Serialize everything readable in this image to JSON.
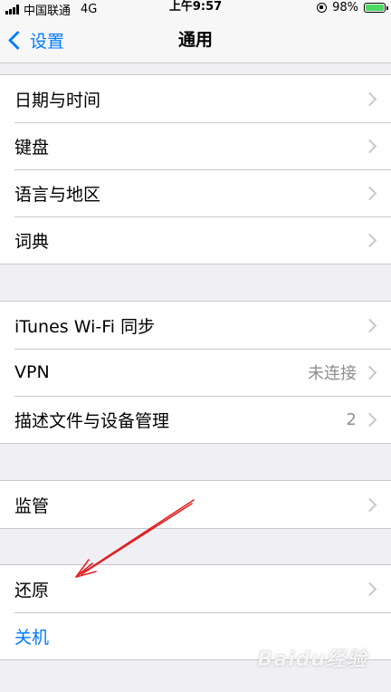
{
  "status_bar": {
    "carrier": "中国联通",
    "network": "4G",
    "time": "上午9:57",
    "battery_percent": "98%",
    "battery_level": 0.98,
    "battery_color": "#4cd964"
  },
  "nav": {
    "back_label": "设置",
    "title": "通用",
    "accent_color": "#007aff"
  },
  "groups": [
    {
      "rows": [
        {
          "label": "日期与时间"
        },
        {
          "label": "键盘"
        },
        {
          "label": "语言与地区"
        },
        {
          "label": "词典"
        }
      ]
    },
    {
      "rows": [
        {
          "label": "iTunes Wi-Fi 同步"
        },
        {
          "label": "VPN",
          "detail": "未连接"
        },
        {
          "label": "描述文件与设备管理",
          "detail": "2"
        }
      ]
    },
    {
      "rows": [
        {
          "label": "监管"
        }
      ]
    },
    {
      "rows": [
        {
          "label": "还原"
        },
        {
          "label": "关机"
        }
      ]
    }
  ],
  "icons": {
    "signal": "cellular-signal-icon",
    "rotation_lock": "rotation-lock-icon",
    "battery": "battery-icon",
    "back": "chevron-left-icon",
    "disclosure": "chevron-right-icon"
  },
  "annotation": {
    "color": "#e02020"
  },
  "watermark": {
    "text": "Baidu经验"
  }
}
